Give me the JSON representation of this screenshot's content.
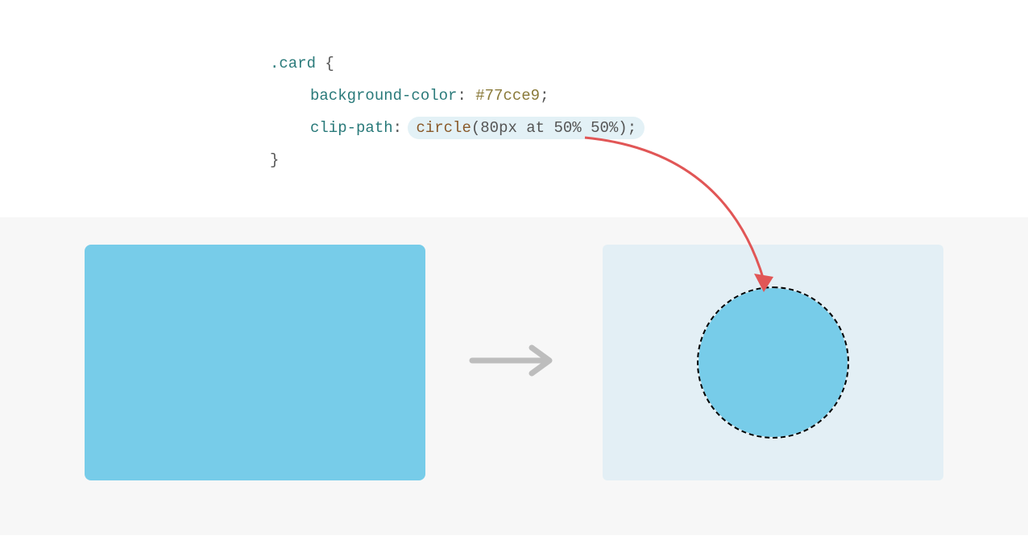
{
  "code": {
    "selector": ".card",
    "brace_open": "{",
    "brace_close": "}",
    "line1": {
      "property": "background-color",
      "value": "#77cce9"
    },
    "line2": {
      "property": "clip-path",
      "value_func": "circle",
      "value_open": "(",
      "value_param": "80px at 50% 50%",
      "value_close": ")",
      "semicolon": ";"
    },
    "colon": ":",
    "space": " ",
    "semicolon": ";"
  },
  "colors": {
    "card_bg": "#77cce9",
    "panel_bg": "#f7f7f7",
    "after_bg": "#e3eff5",
    "highlight_bg": "#e3f1f6",
    "arrow_gray": "#bdbdbd",
    "arrow_red": "#e15656"
  }
}
